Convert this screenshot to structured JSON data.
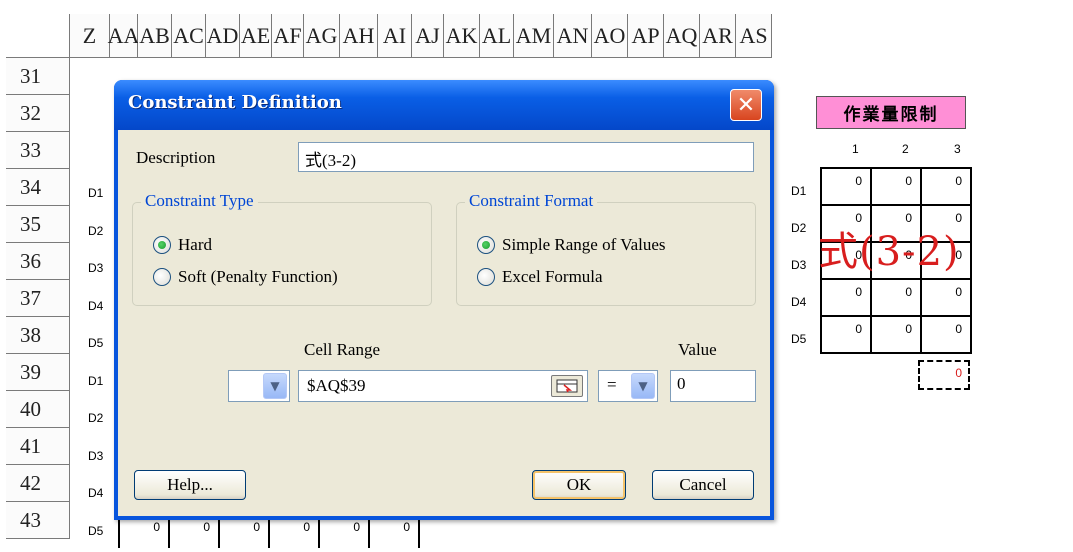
{
  "sheet": {
    "columns": [
      "Z",
      "AA",
      "AB",
      "AC",
      "AD",
      "AE",
      "AF",
      "AG",
      "AH",
      "AI",
      "AJ",
      "AK",
      "AL",
      "AM",
      "AN",
      "AO",
      "AP",
      "AQ",
      "AR",
      "AS"
    ],
    "rows": [
      "31",
      "32",
      "33",
      "34",
      "35",
      "36",
      "37",
      "38",
      "39",
      "40",
      "41",
      "42",
      "43"
    ],
    "left_row_labels": [
      "D1",
      "D2",
      "D3",
      "D4",
      "D5",
      "D1",
      "D2",
      "D3",
      "D4",
      "D5"
    ],
    "bottom_row_values": [
      "0",
      "0",
      "0",
      "0",
      "0",
      "0"
    ],
    "right_table": {
      "title": "作業量限制",
      "col_headers": [
        "1",
        "2",
        "3"
      ],
      "row_labels": [
        "D1",
        "D2",
        "D3",
        "D4",
        "D5"
      ],
      "cells": [
        [
          "0",
          "0",
          "0"
        ],
        [
          "0",
          "0",
          "0"
        ],
        [
          "0",
          "0",
          "0"
        ],
        [
          "0",
          "0",
          "0"
        ],
        [
          "0",
          "0",
          "0"
        ]
      ],
      "overlay_text": "式(3-2)",
      "target_cell_value": "0"
    }
  },
  "dialog": {
    "title": "Constraint Definition",
    "description_label": "Description",
    "description_value": "式(3-2)",
    "constraint_type": {
      "title": "Constraint Type",
      "options": [
        "Hard",
        "Soft (Penalty Function)"
      ],
      "selected": "Hard"
    },
    "constraint_format": {
      "title": "Constraint Format",
      "options": [
        "Simple Range of Values",
        "Excel Formula"
      ],
      "selected": "Simple Range of Values"
    },
    "cell_range_label": "Cell Range",
    "cell_range_value": "$AQ$39",
    "operator": "=",
    "value_label": "Value",
    "value": "0",
    "buttons": {
      "help": "Help...",
      "ok": "OK",
      "cancel": "Cancel"
    }
  },
  "colors": {
    "titlebar": "#0a5fe6",
    "dialog_bg": "#ece9d8",
    "group_title": "#0046d5",
    "title_box": "#ff8fd6",
    "overlay_red": "#d81e1e"
  },
  "icons": [
    "close-icon",
    "chevron-down-icon",
    "range-select-icon"
  ]
}
